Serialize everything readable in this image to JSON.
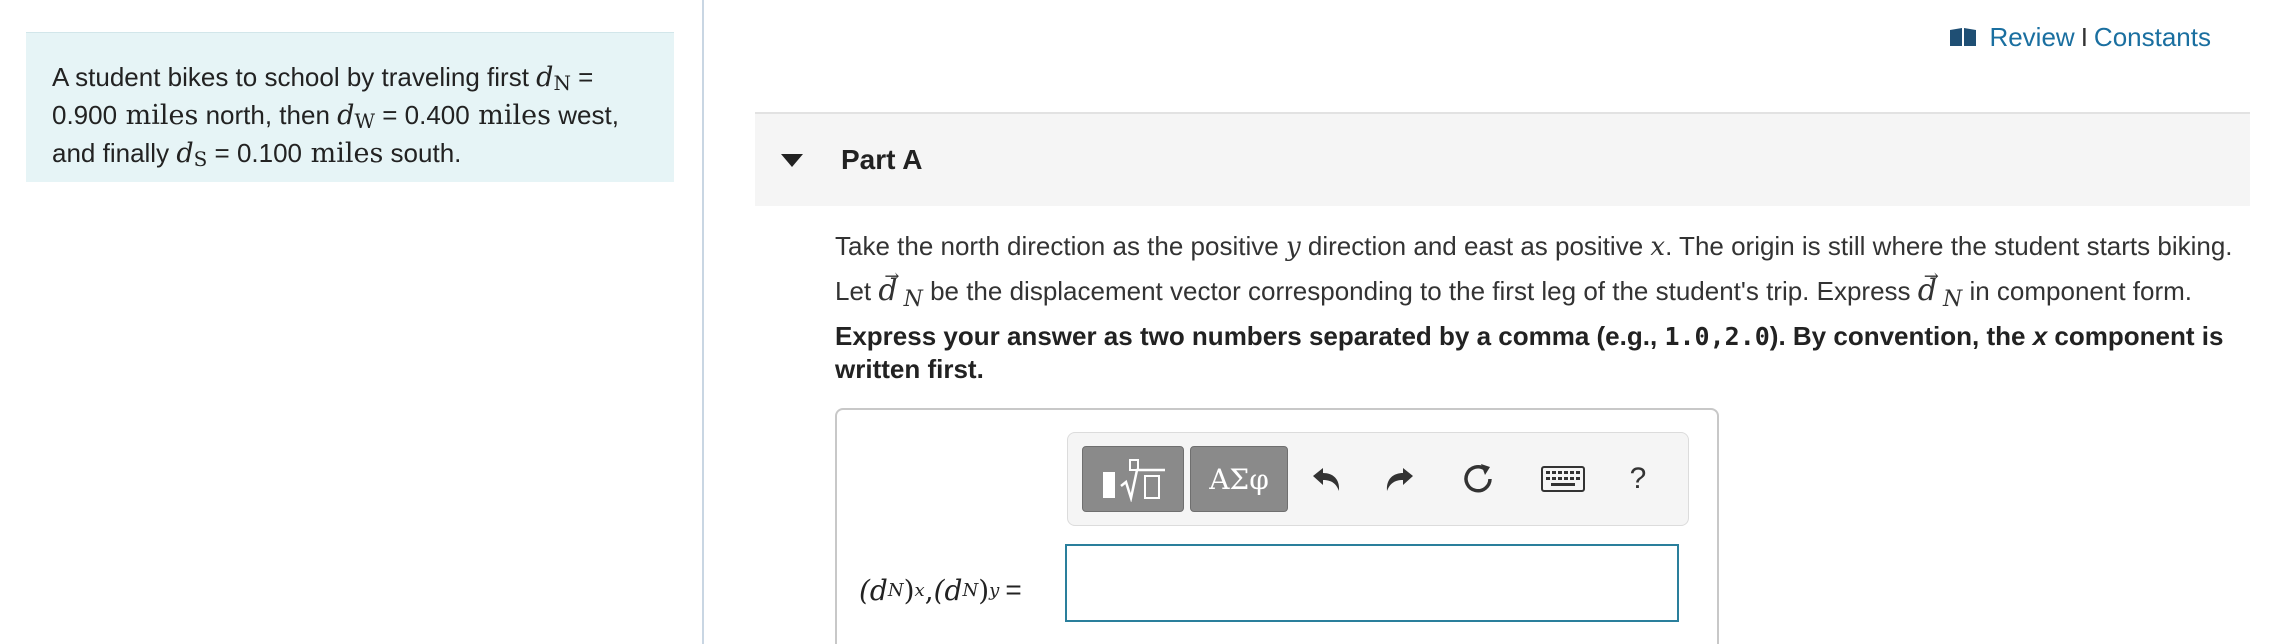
{
  "intro": {
    "p1": "A student bikes to school by traveling first ",
    "d": "d",
    "sub_n": "N",
    "eq1": " = ",
    "v1": "0.900",
    "unit1": " miles",
    "t2": " north, then ",
    "sub_w": "W",
    "eq2": " = ",
    "v2": "0.400",
    "unit2": " miles",
    "t3": " west, and finally ",
    "sub_s": "S",
    "eq3": " = ",
    "v3": "0.100",
    "unit3": " miles",
    "t4": " south."
  },
  "header": {
    "review": "Review",
    "sep": "I",
    "constants": "Constants"
  },
  "part": {
    "title": "Part A"
  },
  "question": {
    "s1": "Take the north direction as the positive ",
    "y": "y",
    "s2": " direction and east as positive ",
    "x": "x",
    "s3": ". The origin is still where the student starts biking. Let ",
    "vec_d": "d",
    "vec_sub": "N",
    "s4": " be the displacement vector corresponding to the first leg of the student's trip. Express ",
    "s5": " in component form."
  },
  "instruction": {
    "a": "Express your answer as two numbers separated by a comma (e.g., ",
    "code": "1.0,2.0",
    "b": "). By convention, the ",
    "x": "x",
    "c": " component is written first."
  },
  "toolbar": {
    "greek_label": "ΑΣφ",
    "help_label": "?"
  },
  "answer": {
    "label_open": "(d",
    "label_sub_n": "N",
    "label_close": ")",
    "label_x": "x",
    "comma": " ,",
    "label_y": "y",
    "equals": " =",
    "value": ""
  },
  "colors": {
    "intro_bg": "#e6f4f6",
    "link": "#1a6fa0",
    "input_border": "#2a7f9c",
    "button_gray": "#8a8a8a"
  },
  "icons": [
    "book-icon",
    "caret-down-icon",
    "templates-icon",
    "undo-icon",
    "redo-icon",
    "reset-icon",
    "keyboard-icon",
    "help-icon"
  ]
}
